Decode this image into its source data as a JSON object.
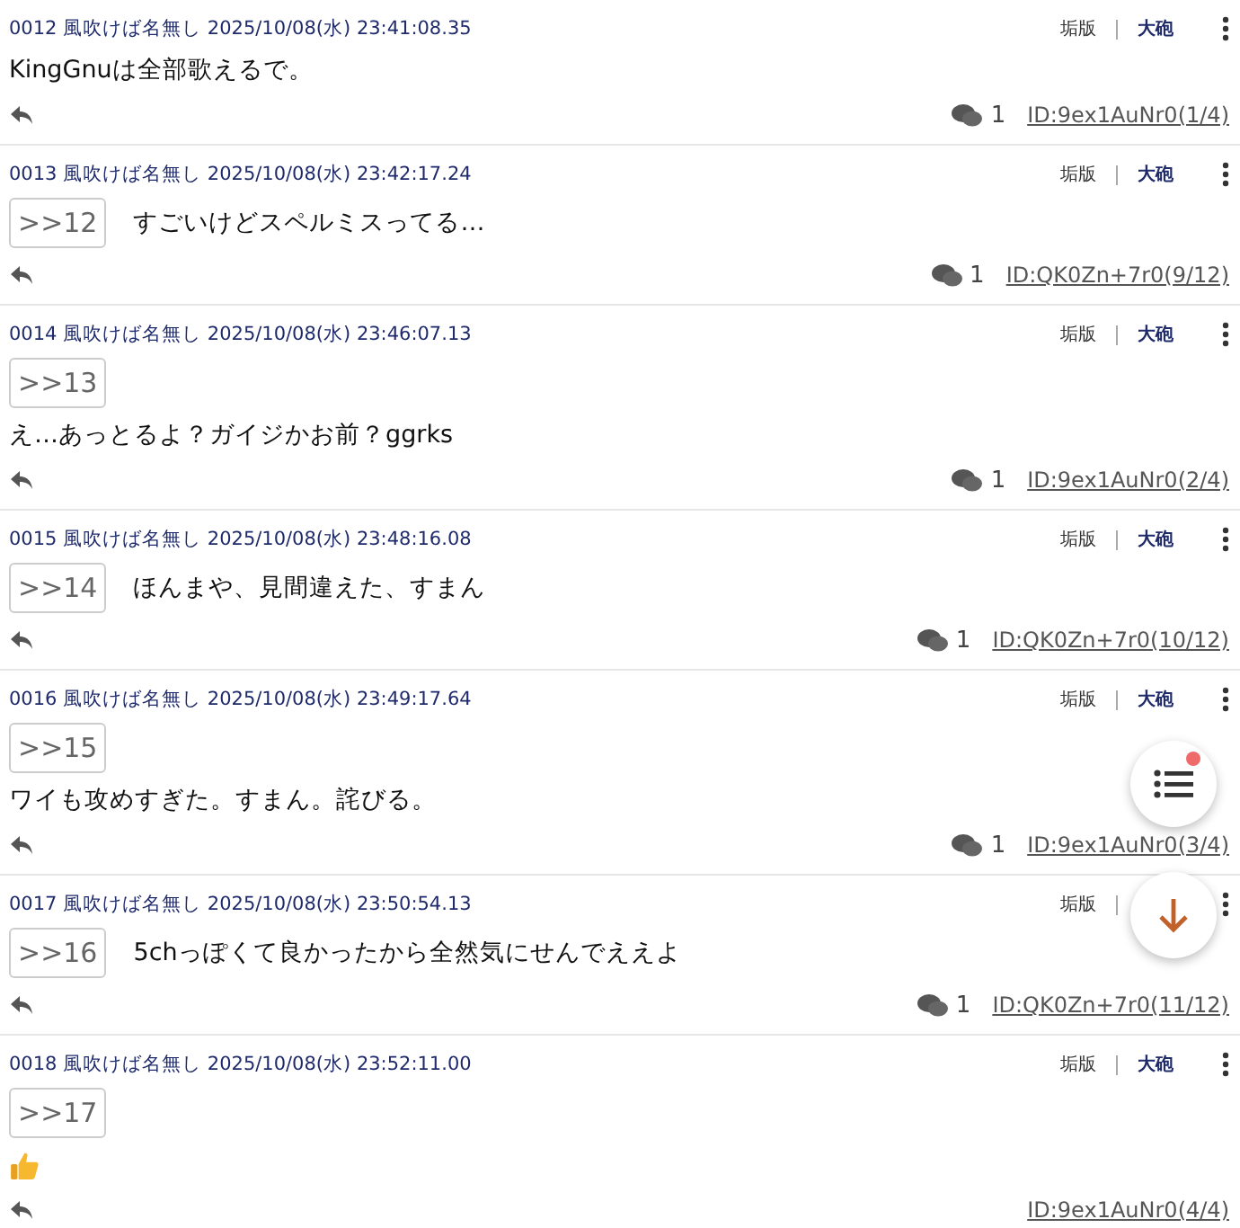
{
  "posts": [
    {
      "number": "0012",
      "name": "風吹けば名無し",
      "date": "2025/10/08(水) 23:41:08.35",
      "report": "垢版",
      "cannon": "大砲",
      "body": "KingGnuは全部歌えるで。",
      "replies": "1",
      "id": "ID:9ex1AuNr0(1/4)"
    },
    {
      "number": "0013",
      "name": "風吹けば名無し",
      "date": "2025/10/08(水) 23:42:17.24",
      "report": "垢版",
      "cannon": "大砲",
      "anchor": ">>12",
      "anchor_inline": true,
      "body": "すごいけどスペルミスってる…",
      "replies": "1",
      "id": "ID:QK0Zn+7r0(9/12)"
    },
    {
      "number": "0014",
      "name": "風吹けば名無し",
      "date": "2025/10/08(水) 23:46:07.13",
      "report": "垢版",
      "cannon": "大砲",
      "anchor": ">>13",
      "anchor_inline": false,
      "body": "え…あっとるよ？ガイジかお前？ggrks",
      "replies": "1",
      "id": "ID:9ex1AuNr0(2/4)"
    },
    {
      "number": "0015",
      "name": "風吹けば名無し",
      "date": "2025/10/08(水) 23:48:16.08",
      "report": "垢版",
      "cannon": "大砲",
      "anchor": ">>14",
      "anchor_inline": true,
      "body": "ほんまや、見間違えた、すまん",
      "replies": "1",
      "id": "ID:QK0Zn+7r0(10/12)"
    },
    {
      "number": "0016",
      "name": "風吹けば名無し",
      "date": "2025/10/08(水) 23:49:17.64",
      "report": "垢版",
      "cannon": "大砲",
      "anchor": ">>15",
      "anchor_inline": false,
      "body": "ワイも攻めすぎた。すまん。詫びる。",
      "replies": "1",
      "id": "ID:9ex1AuNr0(3/4)"
    },
    {
      "number": "0017",
      "name": "風吹けば名無し",
      "date": "2025/10/08(水) 23:50:54.13",
      "report": "垢版",
      "anchor": ">>16",
      "anchor_inline": true,
      "body": "5chっぽくて良かったから全然気にせんでええよ",
      "replies": "1",
      "id": "ID:QK0Zn+7r0(11/12)"
    },
    {
      "number": "0018",
      "name": "風吹けば名無し",
      "date": "2025/10/08(水) 23:52:11.00",
      "report": "垢版",
      "cannon": "大砲",
      "anchor": ">>17",
      "anchor_inline": false,
      "thumbs_up": true,
      "id": "ID:9ex1AuNr0(4/4)"
    }
  ],
  "fab": {
    "list_badge": true
  }
}
